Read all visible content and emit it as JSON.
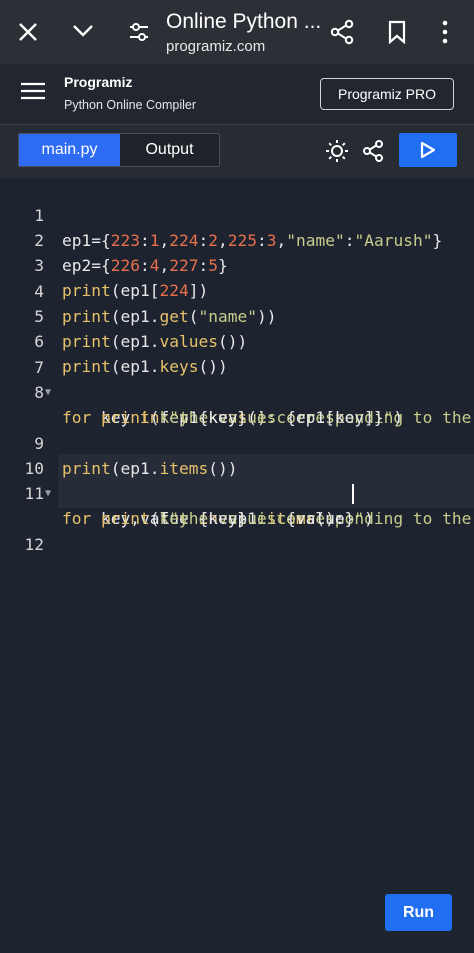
{
  "browser": {
    "title": "Online Python ...",
    "url": "programiz.com"
  },
  "app": {
    "logo": "Programiz",
    "subtitle": "Python Online Compiler",
    "pro_button": "Programiz PRO"
  },
  "tabs": [
    {
      "label": "main.py",
      "active": true
    },
    {
      "label": "Output",
      "active": false
    }
  ],
  "editor": {
    "line_numbers": [
      "1",
      "2",
      "3",
      "4",
      "5",
      "6",
      "7",
      "8",
      "",
      "9",
      "10",
      "11",
      "",
      "12"
    ],
    "lines": [
      "ep1={223:1,224:2,225:3,\"name\":\"Aarush\"}",
      "ep2={226:4,227:5}",
      "print(ep1[224])",
      "print(ep1.get(\"name\"))",
      "print(ep1.values())",
      "print(ep1.keys())",
      "for key in ep1.keys():",
      "    print(f\"the value corresponding to the",
      "        key {key} is {ep1[key]}\")",
      "print(ep1.items())",
      "for key,value in ep1.items():",
      "    print(f\"the value corresponding to the",
      "        key {key} is {value}\")",
      ""
    ]
  },
  "run_button": "Run",
  "colors": {
    "accent": "#1f6ff0",
    "editor_bg": "#1e2330",
    "keyword": "#e7c26a",
    "number": "#e8704d",
    "string": "#c7cc8a"
  }
}
